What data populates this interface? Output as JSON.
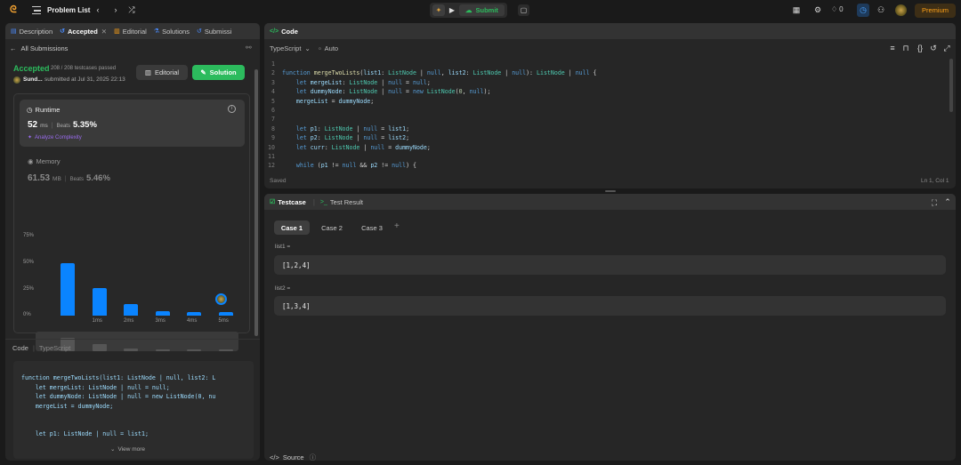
{
  "topbar": {
    "problem_list": "Problem List",
    "submit": "Submit",
    "streak": "0",
    "premium": "Premium"
  },
  "left": {
    "tabs": [
      {
        "label": "Description"
      },
      {
        "label": "Accepted"
      },
      {
        "label": "Editorial"
      },
      {
        "label": "Solutions"
      },
      {
        "label": "Submissi"
      }
    ],
    "all_submissions": "All Submissions",
    "status": "Accepted",
    "testcases": "208 / 208 testcases passed",
    "user": "Sund...",
    "submitted": "submitted at Jul 31, 2025 22:13",
    "editorial_btn": "Editorial",
    "solution_btn": "Solution",
    "runtime": {
      "label": "Runtime",
      "value": "52",
      "unit": "ms",
      "beats_label": "Beats",
      "beats": "5.35%",
      "analyze": "Analyze Complexity"
    },
    "memory": {
      "label": "Memory",
      "value": "61.53",
      "unit": "MB",
      "beats_label": "Beats",
      "beats": "5.46%"
    },
    "code_tabs": {
      "code": "Code",
      "lang": "TypeScript"
    },
    "view_more": "View more",
    "snippet": [
      "function mergeTwoLists(list1: ListNode | null, list2: L",
      "    let mergeList: ListNode | null = null;",
      "    let dummyNode: ListNode | null = new ListNode(0, nu",
      "    mergeList = dummyNode;",
      "",
      "",
      "    let p1: ListNode | null = list1;"
    ]
  },
  "chart_data": {
    "type": "bar",
    "categories": [
      "",
      "1ms",
      "2ms",
      "3ms",
      "4ms",
      "5ms"
    ],
    "values": [
      50,
      26,
      11,
      4,
      3,
      3
    ],
    "y_ticks": [
      "75%",
      "50%",
      "25%",
      "0%"
    ],
    "ylim": [
      0,
      75
    ],
    "accent": "#0a84ff"
  },
  "code": {
    "title": "Code",
    "language": "TypeScript",
    "auto": "Auto",
    "saved": "Saved",
    "cursor": "Ln 1, Col 1"
  },
  "testcase": {
    "tab1": "Testcase",
    "tab2": "Test Result",
    "cases": [
      "Case 1",
      "Case 2",
      "Case 3"
    ],
    "inputs": [
      {
        "label": "list1 =",
        "value": "[1,2,4]"
      },
      {
        "label": "list2 =",
        "value": "[1,3,4]"
      }
    ],
    "source": "Source"
  }
}
